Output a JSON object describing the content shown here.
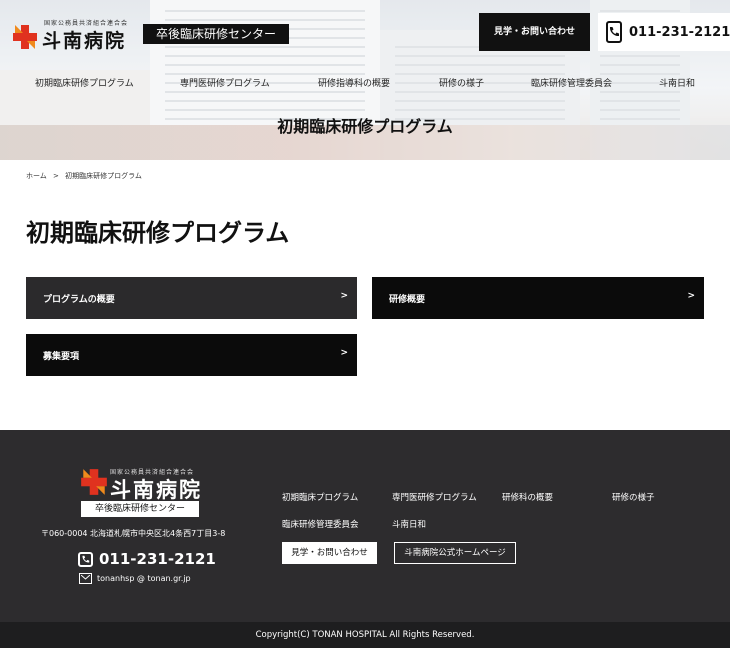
{
  "header": {
    "logo_org": "国家公務員共済組合連合会",
    "logo_name": "斗南病院",
    "center_tag": "卒後臨床研修センター",
    "contact_label": "見学・お問い合わせ",
    "phone": "011-231-2121",
    "nav": [
      {
        "label": "初期臨床研修プログラム"
      },
      {
        "label": "専門医研修プログラム"
      },
      {
        "label": "研修指導科の概要"
      },
      {
        "label": "研修の様子"
      },
      {
        "label": "臨床研修管理委員会"
      },
      {
        "label": "斗南日和"
      }
    ],
    "hero_title": "初期臨床研修プログラム"
  },
  "breadcrumb": {
    "home": "ホーム",
    "separator": ">",
    "current": "初期臨床研修プログラム"
  },
  "main": {
    "title": "初期臨床研修プログラム",
    "cards": [
      {
        "label": "プログラムの概要",
        "arrow": ">"
      },
      {
        "label": "研修概要",
        "arrow": ">"
      },
      {
        "label": "募集要項",
        "arrow": ">"
      }
    ]
  },
  "footer": {
    "logo_org": "国家公務員共済組合連合会",
    "logo_name": "斗南病院",
    "center_tag": "卒後臨床研修センター",
    "address": "〒060-0004 北海道札幌市中央区北4条西7丁目3-8",
    "phone": "011-231-2121",
    "email": "tonanhsp @ tonan.gr.jp",
    "nav": [
      {
        "label": "初期臨床プログラム"
      },
      {
        "label": "専門医研修プログラム"
      },
      {
        "label": "研修科の概要"
      },
      {
        "label": "研修の様子"
      },
      {
        "label": "臨床研修管理委員会"
      },
      {
        "label": "斗南日和"
      }
    ],
    "contact_button": "見学・お問い合わせ",
    "official_button": "斗南病院公式ホームページ",
    "copyright": "Copyright(C) TONAN HOSPITAL All Rights Reserved."
  },
  "colors": {
    "accent_red": "#e0321f",
    "accent_orange": "#f08a1c",
    "dark": "#111111",
    "footer_bg": "#2d2c2e"
  }
}
